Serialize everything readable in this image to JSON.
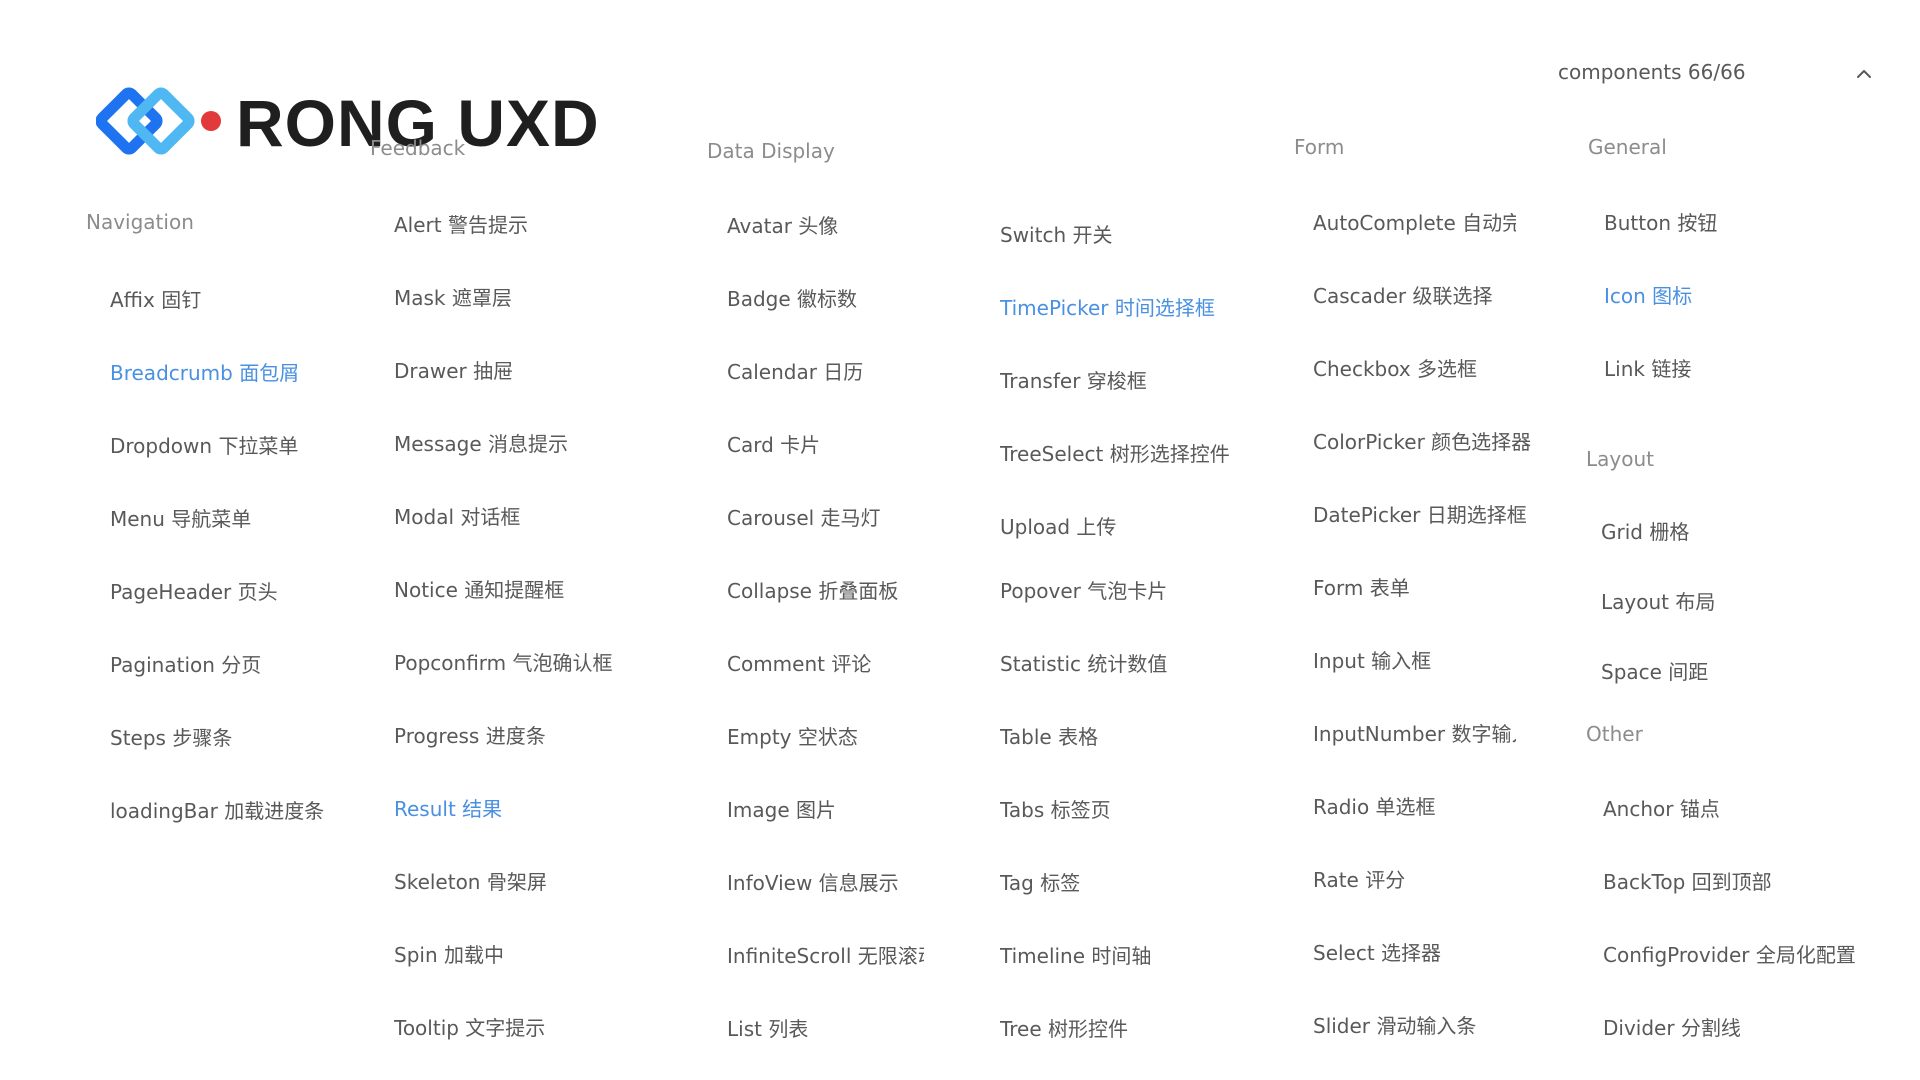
{
  "brand": {
    "name": "RONG UXD",
    "logo_colors": [
      "#1e73f0",
      "#4fb8f2",
      "#e23a3a"
    ]
  },
  "header": {
    "counter": "components 66/66",
    "collapse_icon": "chevron-up-icon"
  },
  "colors": {
    "text": "#595959",
    "category": "#8c8c8c",
    "active": "#4a90e2"
  },
  "categories": {
    "navigation": "Navigation",
    "feedback": "Feedback",
    "data_display": "Data Display",
    "form": "Form",
    "general": "General",
    "layout": "Layout",
    "other": "Other"
  },
  "navigation": [
    "Affix 固钉",
    "Breadcrumb 面包屑",
    "Dropdown 下拉菜单",
    "Menu 导航菜单",
    "PageHeader 页头",
    "Pagination 分页",
    "Steps 步骤条",
    "loadingBar 加载进度条"
  ],
  "feedback": [
    "Alert 警告提示",
    "Mask 遮罩层",
    "Drawer 抽屉",
    "Message 消息提示",
    "Modal 对话框",
    "Notice 通知提醒框",
    "Popconfirm 气泡确认框",
    "Progress 进度条",
    "Result 结果",
    "Skeleton 骨架屏",
    "Spin 加载中",
    "Tooltip 文字提示"
  ],
  "data_display_a": [
    "Avatar 头像",
    "Badge 徽标数",
    "Calendar 日历",
    "Card 卡片",
    "Carousel 走马灯",
    "Collapse 折叠面板",
    "Comment 评论",
    "Empty 空状态",
    "Image 图片",
    "InfoView 信息展示",
    "InfiniteScroll 无限滚动",
    "List 列表"
  ],
  "data_display_b": [
    "Switch 开关",
    "TimePicker 时间选择框",
    "Transfer 穿梭框",
    "TreeSelect 树形选择控件",
    "Upload 上传",
    "Popover 气泡卡片",
    "Statistic 统计数值",
    "Table 表格",
    "Tabs 标签页",
    "Tag 标签",
    "Timeline 时间轴",
    "Tree 树形控件"
  ],
  "form": [
    "AutoComplete 自动完成",
    "Cascader 级联选择",
    "Checkbox 多选框",
    "ColorPicker 颜色选择器",
    "DatePicker 日期选择框",
    "Form 表单",
    "Input 输入框",
    "InputNumber 数字输入框",
    "Radio 单选框",
    "Rate 评分",
    "Select 选择器",
    "Slider 滑动输入条"
  ],
  "general": [
    "Button 按钮",
    "Icon 图标",
    "Link 链接"
  ],
  "layout": [
    "Grid 栅格",
    "Layout 布局",
    "Space 间距"
  ],
  "other": [
    "Anchor 锚点",
    "BackTop 回到顶部",
    "ConfigProvider 全局化配置",
    "Divider 分割线"
  ]
}
